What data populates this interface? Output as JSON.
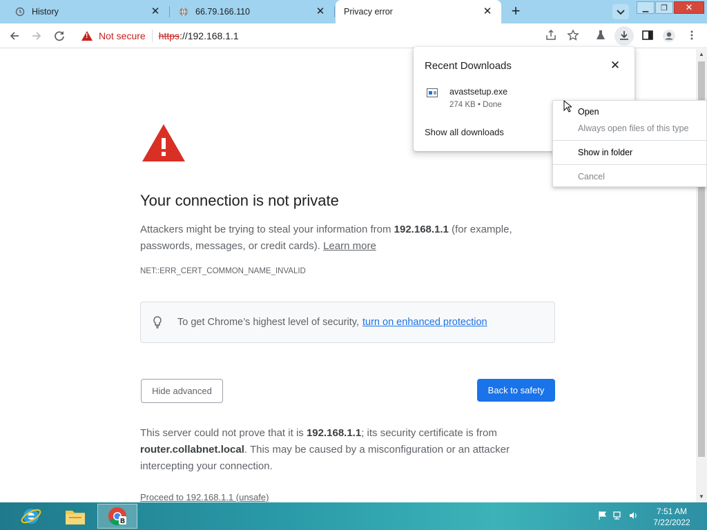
{
  "tabs": [
    {
      "label": "History",
      "close": "✕"
    },
    {
      "label": "66.79.166.110",
      "close": "✕"
    },
    {
      "label": "Privacy error",
      "close": "✕"
    }
  ],
  "new_tab": "+",
  "window_controls": {
    "minimize": "▁",
    "restore": "❐",
    "close": "✕"
  },
  "toolbar": {
    "not_secure": "Not secure",
    "url_scheme": "https",
    "url_rest": "://192.168.1.1"
  },
  "page": {
    "title": "Your connection is not private",
    "desc_pre": "Attackers might be trying to steal your information from ",
    "desc_host": "192.168.1.1",
    "desc_post": " (for example, passwords, messages, or credit cards). ",
    "learn_more": "Learn more",
    "error_code": "NET::ERR_CERT_COMMON_NAME_INVALID",
    "promo_text": "To get Chrome’s highest level of security, ",
    "promo_link": "turn on enhanced protection",
    "hide_advanced": "Hide advanced",
    "back_to_safety": "Back to safety",
    "details_1": "This server could not prove that it is ",
    "details_host": "192.168.1.1",
    "details_2": "; its security certificate is from ",
    "details_issuer": "router.collabnet.local",
    "details_3": ". This may be caused by a misconfiguration or an attacker intercepting your connection.",
    "proceed": "Proceed to 192.168.1.1 (unsafe)"
  },
  "downloads": {
    "title": "Recent Downloads",
    "close": "✕",
    "file_name": "avastsetup.exe",
    "file_status": "274 KB • Done",
    "show_all": "Show all downloads"
  },
  "context_menu": {
    "open": "Open",
    "always_open": "Always open files of this type",
    "show_in_folder": "Show in folder",
    "cancel": "Cancel"
  },
  "taskbar": {
    "time": "7:51 AM",
    "date": "7/22/2022"
  },
  "colors": {
    "accent": "#1a73e8",
    "danger": "#c5221f",
    "tabbar": "#9fd3ef"
  }
}
